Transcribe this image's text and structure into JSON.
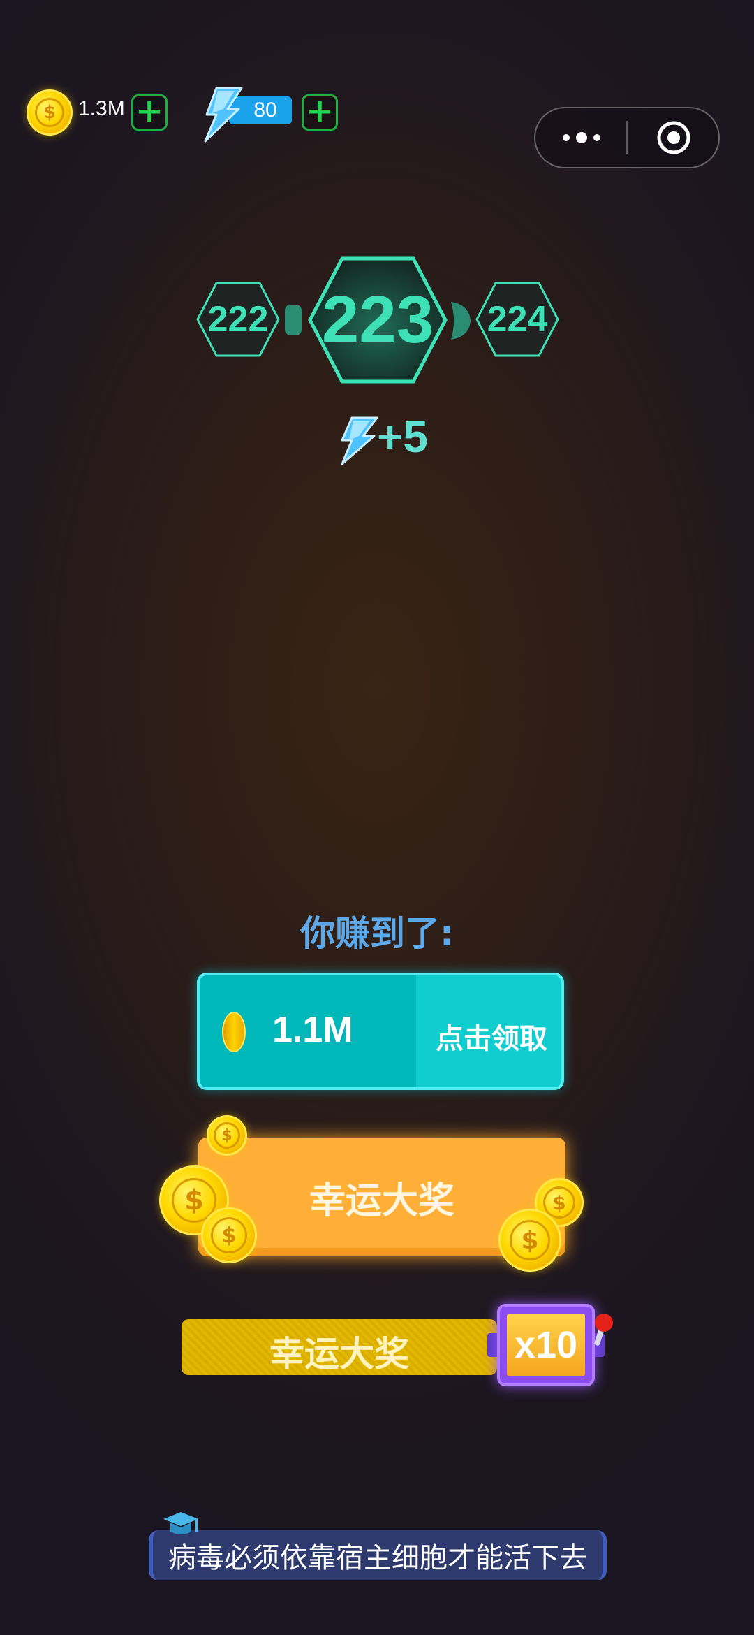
{
  "top_bar": {
    "coins": "1.3M",
    "coin_symbol": "$",
    "energy": "80"
  },
  "levels": {
    "previous": "222",
    "current": "223",
    "next": "224"
  },
  "reward": {
    "energy_bonus": "+5"
  },
  "earnings": {
    "heading": "你赚到了:",
    "amount": "1.1M",
    "claim_label": "点击领取"
  },
  "lucky_prize": {
    "label": "幸运大奖"
  },
  "lucky_prize_multiplier": {
    "label": "幸运大奖",
    "multiplier": "x10"
  },
  "tip": {
    "text": "病毒必须依靠宿主细胞才能活下去"
  },
  "colors": {
    "accent_teal": "#3ee0b5",
    "energy_blue": "#1aa3ea",
    "claim_cyan": "#00b7b9",
    "lucky_orange": "#ffae38",
    "lucky_yellow": "#e2b800",
    "slot_purple": "#8b4cf0"
  }
}
